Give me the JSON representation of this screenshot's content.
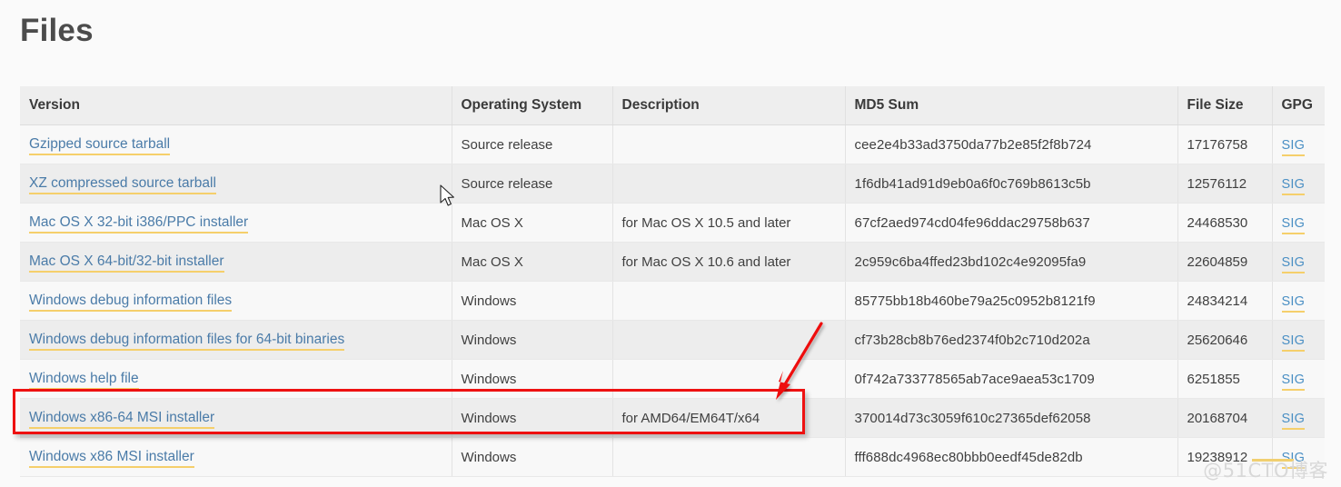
{
  "page": {
    "title": "Files",
    "watermark": "@51CTO博客"
  },
  "table": {
    "columns": [
      {
        "key": "version",
        "label": "Version"
      },
      {
        "key": "os",
        "label": "Operating System"
      },
      {
        "key": "description",
        "label": "Description"
      },
      {
        "key": "md5",
        "label": "MD5 Sum"
      },
      {
        "key": "size",
        "label": "File Size"
      },
      {
        "key": "gpg",
        "label": "GPG"
      }
    ],
    "gpg_label": "SIG",
    "rows": [
      {
        "version": "Gzipped source tarball",
        "os": "Source release",
        "description": "",
        "md5": "cee2e4b33ad3750da77b2e85f2f8b724",
        "size": "17176758",
        "gpg": "SIG"
      },
      {
        "version": "XZ compressed source tarball",
        "os": "Source release",
        "description": "",
        "md5": "1f6db41ad91d9eb0a6f0c769b8613c5b",
        "size": "12576112",
        "gpg": "SIG"
      },
      {
        "version": "Mac OS X 32-bit i386/PPC installer",
        "os": "Mac OS X",
        "description": "for Mac OS X 10.5 and later",
        "md5": "67cf2aed974cd04fe96ddac29758b637",
        "size": "24468530",
        "gpg": "SIG"
      },
      {
        "version": "Mac OS X 64-bit/32-bit installer",
        "os": "Mac OS X",
        "description": "for Mac OS X 10.6 and later",
        "md5": "2c959c6ba4ffed23bd102c4e92095fa9",
        "size": "22604859",
        "gpg": "SIG"
      },
      {
        "version": "Windows debug information files",
        "os": "Windows",
        "description": "",
        "md5": "85775bb18b460be79a25c0952b8121f9",
        "size": "24834214",
        "gpg": "SIG"
      },
      {
        "version": "Windows debug information files for 64-bit binaries",
        "os": "Windows",
        "description": "",
        "md5": "cf73b28cb8b76ed2374f0b2c710d202a",
        "size": "25620646",
        "gpg": "SIG"
      },
      {
        "version": "Windows help file",
        "os": "Windows",
        "description": "",
        "md5": "0f742a733778565ab7ace9aea53c1709",
        "size": "6251855",
        "gpg": "SIG"
      },
      {
        "version": "Windows x86-64 MSI installer",
        "os": "Windows",
        "description": "for AMD64/EM64T/x64",
        "md5": "370014d73c3059f610c27365def62058",
        "size": "20168704",
        "gpg": "SIG"
      },
      {
        "version": "Windows x86 MSI installer",
        "os": "Windows",
        "description": "",
        "md5": "fff688dc4968ec80bbb0eedf45de82db",
        "size": "19238912",
        "gpg": "SIG"
      }
    ]
  },
  "annotation": {
    "highlight_row_index": 7,
    "box_color": "#ee1111",
    "arrow_color": "#ee1111"
  },
  "colors": {
    "background": "#fafafa",
    "header_bg": "#eeeeee",
    "row_odd": "#f8f8f8",
    "row_even": "#ededed",
    "link": "#4a7ba8",
    "link_underline": "#f5cf6b",
    "title": "#4c4c4c",
    "annotation_red": "#ee1111"
  }
}
